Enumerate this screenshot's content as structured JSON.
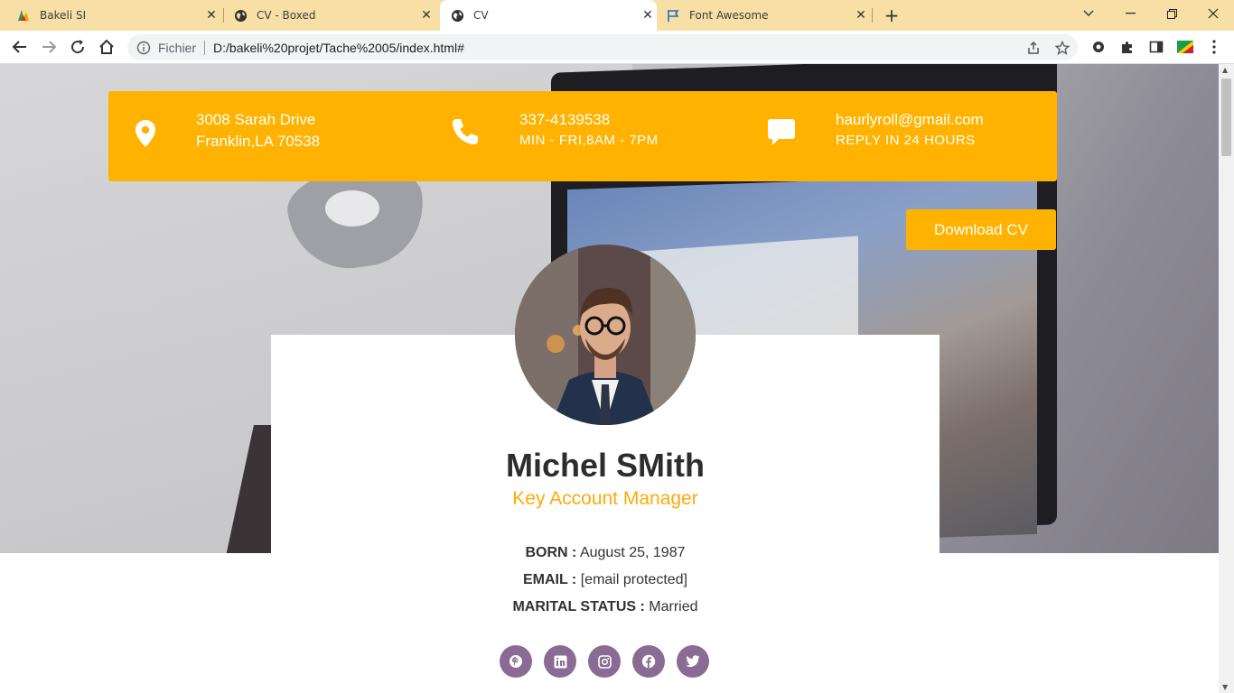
{
  "browser": {
    "tabs": [
      {
        "title": "Bakeli SI",
        "icon": "bakeli-favicon-icon"
      },
      {
        "title": "CV - Boxed",
        "icon": "globe-icon"
      },
      {
        "title": "CV",
        "icon": "globe-icon",
        "active": true
      },
      {
        "title": "Font Awesome",
        "icon": "flag-icon"
      }
    ],
    "omnibox": {
      "label": "Fichier",
      "url": "D:/bakeli%20projet/Tache%2005/index.html#"
    }
  },
  "contact": {
    "address_line1": "3008 Sarah Drive",
    "address_line2": "Franklin,LA 70538",
    "phone": "337-4139538",
    "hours": "MIN - FRI,8AM - 7PM",
    "email": "haurlyroll@gmail.com",
    "reply": "REPLY IN 24 HOURS"
  },
  "actions": {
    "download_label": "Download CV"
  },
  "profile": {
    "name": "Michel SMith",
    "role": "Key Account Manager",
    "born_label": "BORN :",
    "born_value": "August 25, 1987",
    "email_label": "EMAIL :",
    "email_value": "[email protected]",
    "marital_label": "MARITAL STATUS :",
    "marital_value": "Married"
  },
  "socials": [
    "pinterest-icon",
    "linkedin-icon",
    "instagram-icon",
    "facebook-icon",
    "twitter-icon"
  ],
  "colors": {
    "accent": "#ffb300",
    "role_text": "#ffa90b",
    "social_bg": "#8a6b93",
    "tabbar": "#f8dfa6"
  }
}
